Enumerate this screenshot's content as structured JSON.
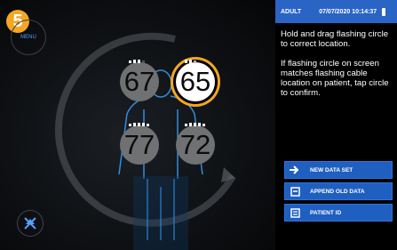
{
  "step_number": "5",
  "menu_label": "MENU",
  "status": {
    "mode": "ADULT",
    "datetime": "07/07/2020 10:14:37"
  },
  "instructions": [
    "Hold and drag flashing circle to correct location.",
    "If flashing circle on screen matches flashing cable location on patient, tap circle to confirm."
  ],
  "sensors": [
    {
      "value": "67",
      "active": false
    },
    {
      "value": "65",
      "active": true
    },
    {
      "value": "77",
      "active": false
    },
    {
      "value": "72",
      "active": false
    }
  ],
  "actions": [
    {
      "label": "NEW DATA SET",
      "icon": "arrow-icon"
    },
    {
      "label": "APPEND OLD DATA",
      "icon": "append-icon"
    },
    {
      "label": "PATIENT ID",
      "icon": "id-card-icon"
    }
  ],
  "colors": {
    "accent": "#f5a623",
    "panel_blue": "#1f5fbf",
    "status_blue": "#2a64c4"
  }
}
